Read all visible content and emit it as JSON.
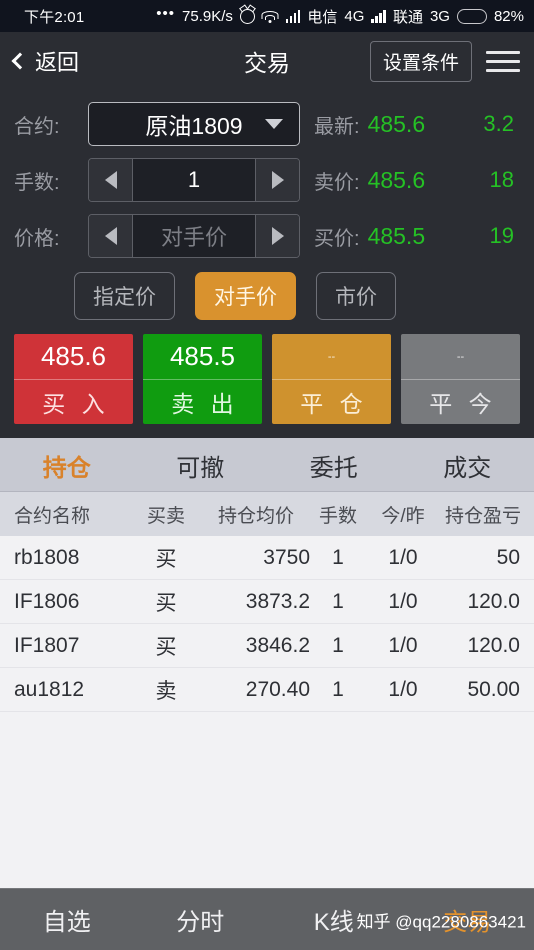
{
  "statusbar": {
    "time": "下午2:01",
    "dots": "•••",
    "speed": "75.9K/s",
    "alarm_icon": "alarm-clock-icon",
    "wifi_icon": "wifi-icon",
    "carrier1": "电信",
    "net1": "4G",
    "carrier2": "联通",
    "net2": "3G",
    "battery_percent": "82%",
    "battery_level": 82,
    "battery_color": "#f5a623"
  },
  "header": {
    "back_label": "返回",
    "title": "交易",
    "condition_button": "设置条件",
    "menu_icon": "hamburger-menu-icon"
  },
  "order_form": {
    "contract_label": "合约:",
    "contract_value": "原油1809",
    "lots_label": "手数:",
    "lots_value": "1",
    "price_label": "价格:",
    "price_value": "对手价",
    "quotes": [
      {
        "label": "最新:",
        "value": "485.6",
        "extra": "3.2"
      },
      {
        "label": "卖价:",
        "value": "485.6",
        "extra": "18"
      },
      {
        "label": "买价:",
        "value": "485.5",
        "extra": "19"
      }
    ],
    "quote_color": "#25c125",
    "price_types": [
      {
        "label": "指定价",
        "active": false
      },
      {
        "label": "对手价",
        "active": true
      },
      {
        "label": "市价",
        "active": false
      }
    ],
    "accent_color": "#d9922e"
  },
  "actions": [
    {
      "price": "485.6",
      "label": "买 入",
      "color": "#cf3338"
    },
    {
      "price": "485.5",
      "label": "卖 出",
      "color": "#109c10"
    },
    {
      "price": "--",
      "label": "平 仓",
      "color": "#cf922e"
    },
    {
      "price": "--",
      "label": "平 今",
      "color": "#787a7d"
    }
  ],
  "positions": {
    "tabs": [
      {
        "label": "持仓",
        "active": true
      },
      {
        "label": "可撤",
        "active": false
      },
      {
        "label": "委托",
        "active": false
      },
      {
        "label": "成交",
        "active": false
      }
    ],
    "columns": [
      "合约名称",
      "买卖",
      "持仓均价",
      "手数",
      "今/昨",
      "持仓盈亏"
    ],
    "rows": [
      {
        "contract": "rb1808",
        "side": "买",
        "avg_price": "3750",
        "lots": "1",
        "today_yesterday": "1/0",
        "pnl": "50"
      },
      {
        "contract": "IF1806",
        "side": "买",
        "avg_price": "3873.2",
        "lots": "1",
        "today_yesterday": "1/0",
        "pnl": "120.0"
      },
      {
        "contract": "IF1807",
        "side": "买",
        "avg_price": "3846.2",
        "lots": "1",
        "today_yesterday": "1/0",
        "pnl": "120.0"
      },
      {
        "contract": "au1812",
        "side": "卖",
        "avg_price": "270.40",
        "lots": "1",
        "today_yesterday": "1/0",
        "pnl": "50.00"
      }
    ]
  },
  "bottomnav": {
    "items": [
      {
        "label": "自选",
        "active": false
      },
      {
        "label": "分时",
        "active": false
      },
      {
        "label": "K线",
        "active": false
      },
      {
        "label": "交易",
        "active": true
      }
    ],
    "watermark": "知乎 @qq2280863421"
  }
}
